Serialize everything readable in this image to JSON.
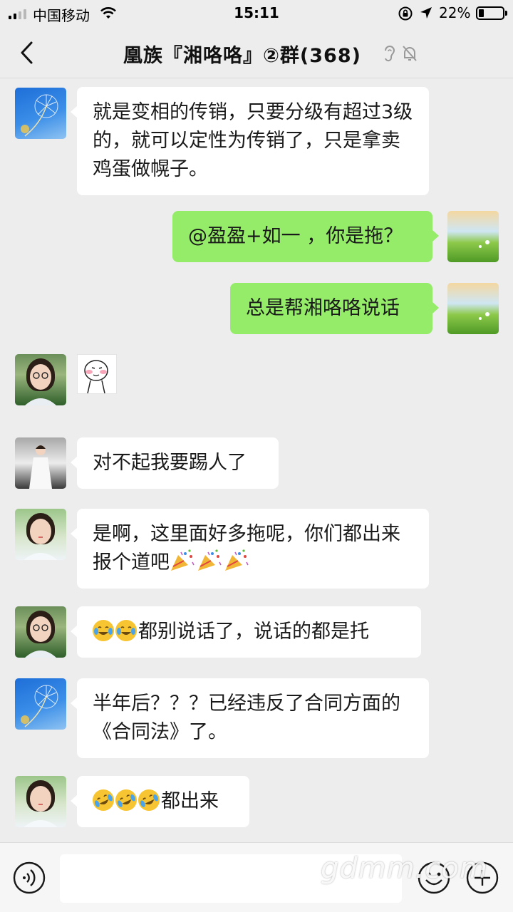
{
  "status_bar": {
    "carrier": "中国移动",
    "time": "15:11",
    "battery_percent": "22%",
    "battery_level": 0.22
  },
  "nav": {
    "title": "凰族『湘咯咯』②群(368)"
  },
  "messages": [
    {
      "side": "left",
      "avatar": "dandelion-avatar",
      "text": "就是变相的传销，只要分级有超过3级的，就可以定性为传销了，只是拿卖鸡蛋做幌子。"
    },
    {
      "side": "right",
      "avatar": "green-field-avatar",
      "text": "@盈盈+如一 ，你是拖？"
    },
    {
      "side": "right",
      "avatar": "green-field-avatar",
      "text": "总是帮湘咯咯说话"
    },
    {
      "side": "left",
      "avatar": "girl-glasses-avatar",
      "sticker": "cartoon-face-sticker"
    },
    {
      "side": "left",
      "avatar": "girl-white-dress-avatar",
      "text": "对不起我要踢人了"
    },
    {
      "side": "left",
      "avatar": "girl-outdoor-avatar",
      "text": "是啊，这里面好多拖呢，你们都出来报个道吧",
      "emoji_suffix": [
        "party-popper-emoji",
        "party-popper-emoji",
        "party-popper-emoji"
      ]
    },
    {
      "side": "left",
      "avatar": "girl-glasses-avatar",
      "emoji_prefix": [
        "tears-of-joy-emoji",
        "tears-of-joy-emoji"
      ],
      "text": "都别说话了，说话的都是托"
    },
    {
      "side": "left",
      "avatar": "dandelion-avatar",
      "text": "半年后？？？已经违反了合同方面的《合同法》了。"
    },
    {
      "side": "left",
      "avatar": "girl-outdoor-avatar",
      "emoji_prefix": [
        "rolling-laughing-emoji",
        "rolling-laughing-emoji",
        "rolling-laughing-emoji"
      ],
      "text": "都出来"
    }
  ],
  "input_bar": {
    "value": "",
    "voice_icon": "voice-icon",
    "emoji_icon": "emoji-icon",
    "plus_icon": "plus-icon"
  },
  "watermark": "gdmm.com",
  "colors": {
    "background": "#ededed",
    "bubble_self": "#95ec69",
    "bubble_other": "#ffffff"
  }
}
